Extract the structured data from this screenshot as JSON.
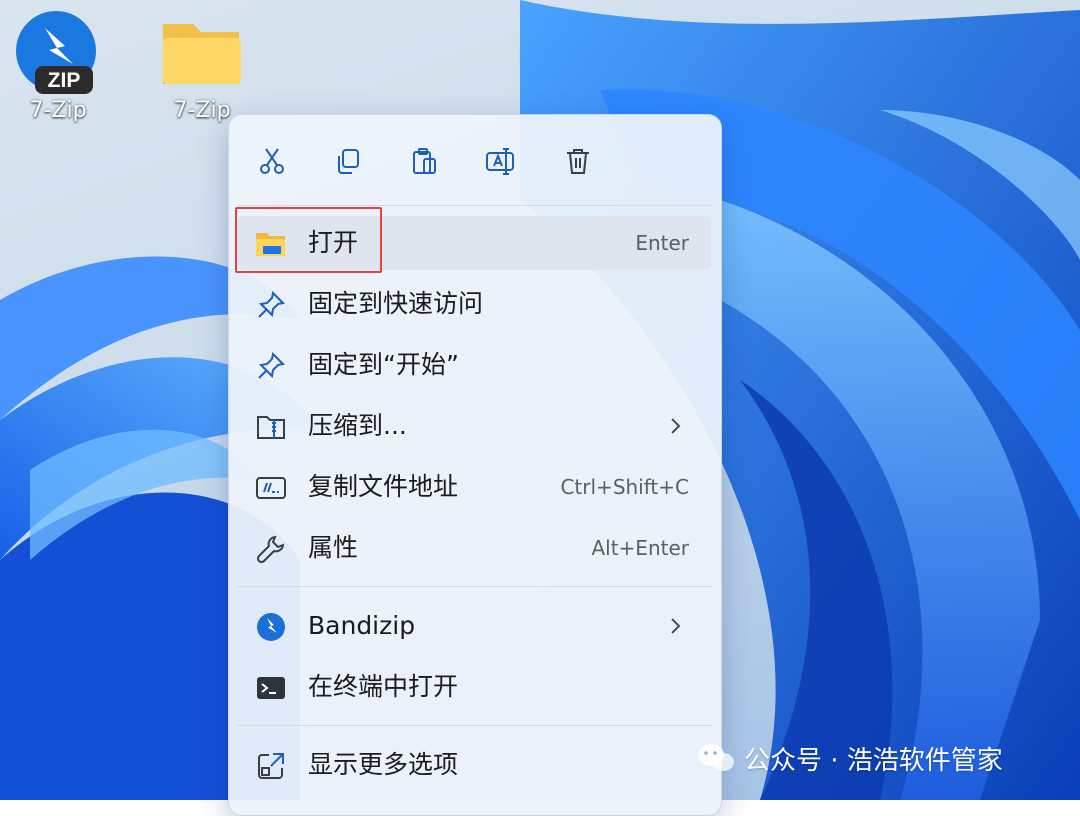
{
  "desktop": {
    "icons": [
      {
        "label": "7-Zip",
        "icon": "bandizip-zip-icon"
      },
      {
        "label": "7-Zip",
        "icon": "folder-icon"
      }
    ]
  },
  "context_menu": {
    "toolbar": [
      {
        "name": "cut",
        "icon": "scissors-icon"
      },
      {
        "name": "copy",
        "icon": "copy-icon"
      },
      {
        "name": "paste",
        "icon": "clipboard-icon"
      },
      {
        "name": "rename",
        "icon": "rename-icon"
      },
      {
        "name": "delete",
        "icon": "trash-icon"
      }
    ],
    "items": [
      {
        "label": "打开",
        "shortcut": "Enter",
        "icon": "folder-open-icon",
        "highlighted": true
      },
      {
        "label": "固定到快速访问",
        "shortcut": "",
        "icon": "pin-icon"
      },
      {
        "label": "固定到“开始”",
        "shortcut": "",
        "icon": "pin-icon"
      },
      {
        "label": "压缩到...",
        "shortcut": "",
        "icon": "zip-folder-icon",
        "submenu": true
      },
      {
        "label": "复制文件地址",
        "shortcut": "Ctrl+Shift+C",
        "icon": "copy-path-icon"
      },
      {
        "label": "属性",
        "shortcut": "Alt+Enter",
        "icon": "wrench-icon"
      },
      {
        "label": "Bandizip",
        "shortcut": "",
        "icon": "bandizip-icon",
        "submenu": true
      },
      {
        "label": "在终端中打开",
        "shortcut": "",
        "icon": "terminal-icon"
      },
      {
        "label": "显示更多选项",
        "shortcut": "",
        "icon": "more-options-icon"
      }
    ]
  },
  "watermark": {
    "text": "公众号 · 浩浩软件管家"
  },
  "colors": {
    "accent": "#0a6fd6",
    "highlight_border": "#e0443c",
    "wallpaper_blue": "#1c68e8"
  }
}
